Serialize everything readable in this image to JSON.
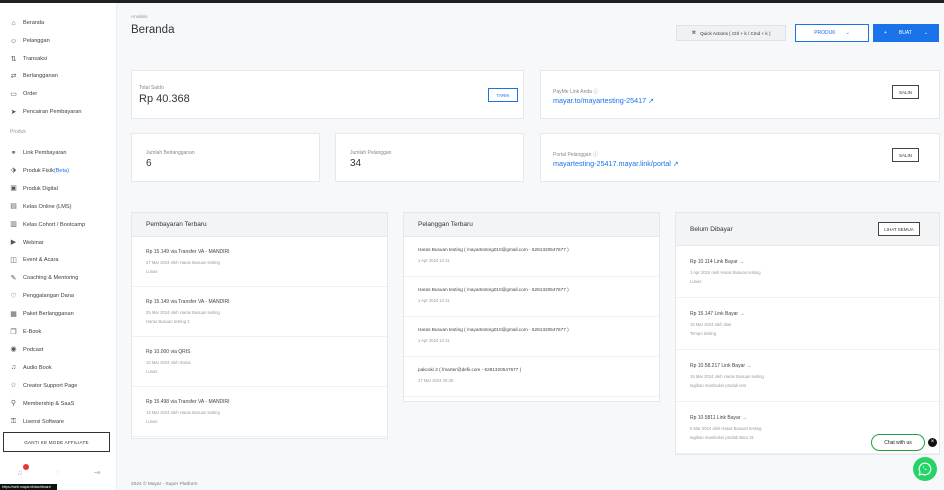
{
  "sidebar": {
    "items": [
      {
        "label": "Beranda",
        "icon": "home-icon",
        "glyph": "⌂"
      },
      {
        "label": "Pelanggan",
        "icon": "users-icon",
        "glyph": "☺"
      },
      {
        "label": "Transaksi",
        "icon": "transactions-icon",
        "glyph": "⇅"
      },
      {
        "label": "Berlangganan",
        "icon": "subscription-icon",
        "glyph": "⇄"
      },
      {
        "label": "Order",
        "icon": "order-icon",
        "glyph": "▭"
      },
      {
        "label": "Pencairan Pembayaran",
        "icon": "payout-icon",
        "glyph": "➤"
      }
    ],
    "section_label": "Produk",
    "product_items": [
      {
        "label": "Link Pembayaran",
        "icon": "link-icon",
        "glyph": "⚭"
      },
      {
        "label": "Produk Fisik",
        "extra": "(Beta)",
        "icon": "tag-icon",
        "glyph": "⬗"
      },
      {
        "label": "Produk Digital",
        "icon": "digital-product-icon",
        "glyph": "▣"
      },
      {
        "label": "Kelas Online (LMS)",
        "icon": "course-icon",
        "glyph": "▤"
      },
      {
        "label": "Kelas Cohort / Bootcamp",
        "icon": "cohort-icon",
        "glyph": "▥"
      },
      {
        "label": "Webinar",
        "icon": "webinar-icon",
        "glyph": "▶"
      },
      {
        "label": "Event & Acara",
        "icon": "event-icon",
        "glyph": "◫"
      },
      {
        "label": "Coaching & Mentoring",
        "icon": "coaching-icon",
        "glyph": "✎"
      },
      {
        "label": "Penggalangan Dana",
        "icon": "fundraising-icon",
        "glyph": "♡"
      },
      {
        "label": "Paket Berlangganan",
        "icon": "package-icon",
        "glyph": "▦"
      },
      {
        "label": "E-Book",
        "icon": "ebook-icon",
        "glyph": "❒"
      },
      {
        "label": "Podcast",
        "icon": "podcast-icon",
        "glyph": "◉"
      },
      {
        "label": "Audio Book",
        "icon": "audiobook-icon",
        "glyph": "♫"
      },
      {
        "label": "Creator Support Page",
        "icon": "creator-icon",
        "glyph": "☆"
      },
      {
        "label": "Membership & SaaS",
        "icon": "membership-icon",
        "glyph": "⚲"
      },
      {
        "label": "Lisensi Software",
        "icon": "license-icon",
        "glyph": "⚿"
      }
    ],
    "affiliate_button": "GANTI KE MODE AFFILIATE",
    "status_text": "https://web.mayar.id/dashboard"
  },
  "header": {
    "breadcrumb": "Analisis",
    "title": "Beranda",
    "quick_actions": "Quick Actions ( Ctrl + k / Cmd + k )",
    "produk_button": "PRODUK",
    "buat_button": "BUAT"
  },
  "cards": {
    "saldo_label": "Total Saldo",
    "saldo_value": "Rp 40.368",
    "saldo_button": "TARIK",
    "payme_label": "PayMe Link Anda",
    "payme_link": "mayar.to/mayartesting-25417",
    "berlangganan_label": "Jumlah Berlangganan",
    "berlangganan_value": "6",
    "pelanggan_label": "Jumlah Pelanggan",
    "pelanggan_value": "34",
    "portal_label": "Portal Pelanggan",
    "portal_link": "mayartesting-25417.mayar.link/portal",
    "copy_label": "SALIN"
  },
  "pembayaran": {
    "title": "Pembayaran Terbaru",
    "rows": [
      {
        "line1": "Rp 15.149 via Transfer VA - MANDIRI",
        "line2": "27 Mar 2024 oleh Haras Busuan testing",
        "line3": "Lunas"
      },
      {
        "line1": "Rp 15.149 via Transfer VA - MANDIRI",
        "line2": "25 Mar 2024 oleh Haras Busuan testing",
        "line3": "Haras Busuan testing 2"
      },
      {
        "line1": "Rp 10.000 via QRIS",
        "line2": "15 Mar 2024 oleh Irama",
        "line3": "Lunas"
      },
      {
        "line1": "Rp 15.498 via Transfer VA - MANDIRI",
        "line2": "14 Mar 2024 oleh Haras Busuan testing",
        "line3": "Lunas"
      }
    ]
  },
  "pelanggan": {
    "title": "Pelanggan Terbaru",
    "rows": [
      {
        "line1": "Haras Busuan testing ( mayartesting010@gmail.com - 6281320547677 )",
        "line2": "1 Apr 2024 12:11"
      },
      {
        "line1": "Haras Busuan testing ( mayartesting010@gmail.com - 6281320547677 )",
        "line2": "1 Apr 2024 12:11"
      },
      {
        "line1": "Haras Busuan testing ( mayartesting010@gmail.com - 6281320547677 )",
        "line2": "1 Apr 2024 12:11"
      },
      {
        "line1": "pakcoki 2 ( fmarter@defii.com - 6281320547677 )",
        "line2": "27 Mar 2024 20:35"
      }
    ]
  },
  "belum_dibayar": {
    "title": "Belum Dibayar",
    "button": "LIHAT SEMUA",
    "rows": [
      {
        "line1": "Rp 10.114 Link Bayar →",
        "line2": "1 Apr 2024 oleh Haras Busuan testing",
        "line3": "Lunas"
      },
      {
        "line1": "Rp 15.147 Link Bayar →",
        "line2": "15 Mar 2024 oleh Ilias",
        "line3": "Tempo testing"
      },
      {
        "line1": "Rp 10.58.217 Link Bayar →",
        "line2": "15 Mar 2024 oleh Haras Busuan testing",
        "line3": "tagihan mambukin produk test"
      },
      {
        "line1": "Rp 10.5811 Link Bayar →",
        "line2": "5 Mar 2024 oleh Haras Busuan testing",
        "line3": "tagihan mambukin produk Baru 01"
      }
    ]
  },
  "footer": "2024 © Mayar - Super Platform",
  "chat": {
    "label": "Chat with us",
    "close": "×"
  },
  "colors": {
    "accent": "#1a73e8",
    "whatsapp": "#25d366"
  }
}
